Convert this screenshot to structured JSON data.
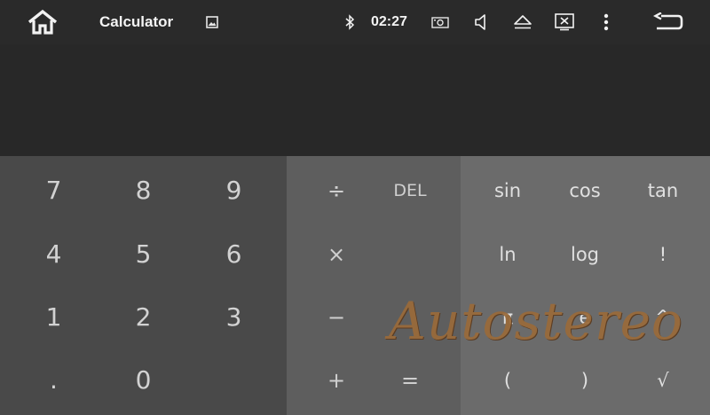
{
  "status_bar": {
    "app_title": "Calculator",
    "time": "02:27",
    "icons": [
      "home-icon",
      "image-icon",
      "bluetooth-icon",
      "camera-icon",
      "volume-icon",
      "eject-icon",
      "screen-off-icon",
      "more-vert-icon",
      "back-icon"
    ]
  },
  "display": {
    "expression": "",
    "result": ""
  },
  "keypad": {
    "numbers": [
      {
        "label": "7",
        "name": "key-7"
      },
      {
        "label": "8",
        "name": "key-8"
      },
      {
        "label": "9",
        "name": "key-9"
      },
      {
        "label": "4",
        "name": "key-4"
      },
      {
        "label": "5",
        "name": "key-5"
      },
      {
        "label": "6",
        "name": "key-6"
      },
      {
        "label": "1",
        "name": "key-1"
      },
      {
        "label": "2",
        "name": "key-2"
      },
      {
        "label": "3",
        "name": "key-3"
      },
      {
        "label": ".",
        "name": "key-decimal"
      },
      {
        "label": "0",
        "name": "key-0"
      }
    ],
    "operators": [
      {
        "label": "÷",
        "name": "key-divide"
      },
      {
        "label": "DEL",
        "name": "key-delete"
      },
      {
        "label": "×",
        "name": "key-multiply"
      },
      {
        "label": "−",
        "name": "key-minus"
      },
      {
        "label": "+",
        "name": "key-plus"
      },
      {
        "label": "=",
        "name": "key-equals"
      }
    ],
    "advanced": [
      {
        "label": "sin",
        "name": "key-sin"
      },
      {
        "label": "cos",
        "name": "key-cos"
      },
      {
        "label": "tan",
        "name": "key-tan"
      },
      {
        "label": "ln",
        "name": "key-ln"
      },
      {
        "label": "log",
        "name": "key-log"
      },
      {
        "label": "!",
        "name": "key-factorial"
      },
      {
        "label": "π",
        "name": "key-pi"
      },
      {
        "label": "e",
        "name": "key-e"
      },
      {
        "label": "^",
        "name": "key-power"
      },
      {
        "label": "(",
        "name": "key-open-paren"
      },
      {
        "label": ")",
        "name": "key-close-paren"
      },
      {
        "label": "√",
        "name": "key-sqrt"
      }
    ]
  },
  "watermark": "Autostereo",
  "colors": {
    "status_bar": "#2a2a2a",
    "display": "#282828",
    "number_pad": "#494949",
    "operator_pad": "#5e5e5e",
    "advanced_pad": "#6b6b6b",
    "key_text": "#d0d0d0",
    "watermark": "#9a6a3a"
  }
}
